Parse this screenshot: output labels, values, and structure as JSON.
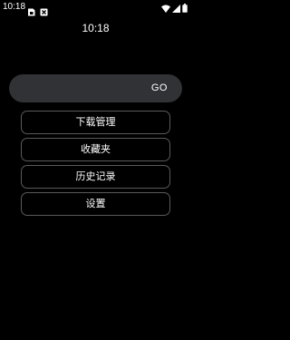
{
  "status_bar": {
    "time": "10:18",
    "left_icons": [
      "sim-card-icon",
      "notification-box-icon"
    ],
    "right_icons": [
      "wifi-icon",
      "signal-icon",
      "battery-icon"
    ]
  },
  "clock": {
    "time": "10:18"
  },
  "search": {
    "value": "",
    "go_label": "GO"
  },
  "menu": {
    "items": [
      {
        "label": "下载管理"
      },
      {
        "label": "收藏夹"
      },
      {
        "label": "历史记录"
      },
      {
        "label": "设置"
      }
    ]
  },
  "colors": {
    "background": "#000000",
    "search_bg": "#303236",
    "menu_border": "#5a5a5a",
    "text": "#ffffff"
  }
}
